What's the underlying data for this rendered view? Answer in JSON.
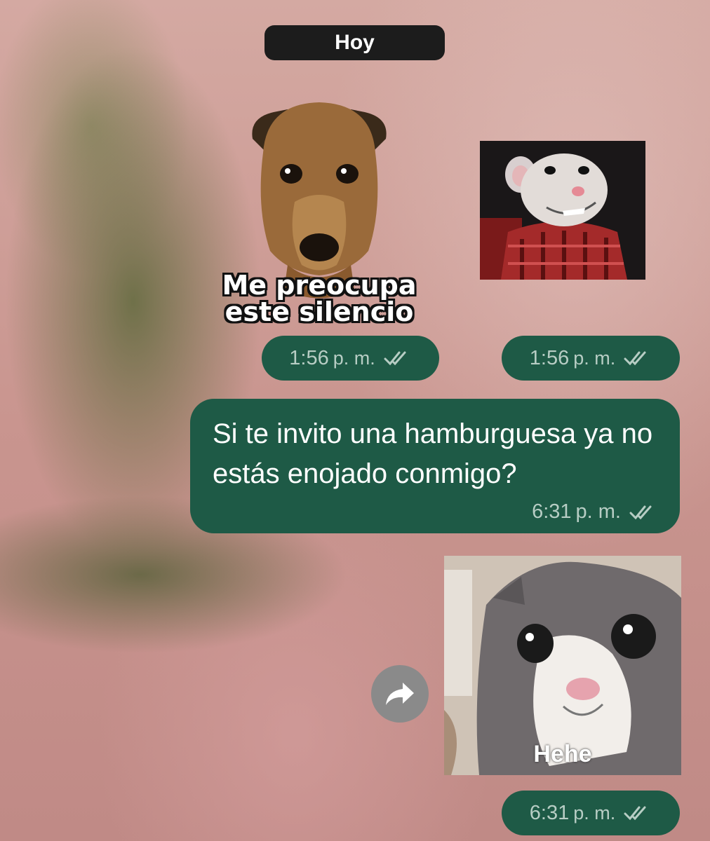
{
  "chat": {
    "day_label": "Hoy",
    "messages": [
      {
        "type": "sticker",
        "sticker_name": "dog-sticker",
        "caption": "Me preocupa este silencio",
        "time": "1:56",
        "meridiem": "p. m.",
        "status": "double-check-icon"
      },
      {
        "type": "sticker",
        "sticker_name": "mouse-sticker",
        "caption": "",
        "time": "1:56",
        "meridiem": "p. m.",
        "status": "double-check-icon"
      },
      {
        "type": "text",
        "text": "Si te invito una hamburguesa ya no estás enojado conmigo?",
        "time": "6:31",
        "meridiem": "p. m.",
        "status": "double-check-icon"
      },
      {
        "type": "sticker",
        "sticker_name": "cat-sticker",
        "caption": "Hehe",
        "time": "6:31",
        "meridiem": "p. m.",
        "status": "double-check-icon"
      }
    ],
    "forward_icon": "forward-arrow-icon"
  },
  "colors": {
    "bubble": "#1e5a46",
    "meta_text": "#b7cdc4",
    "day_chip": "#1c1c1c",
    "forward_button": "#8a8a8a"
  }
}
